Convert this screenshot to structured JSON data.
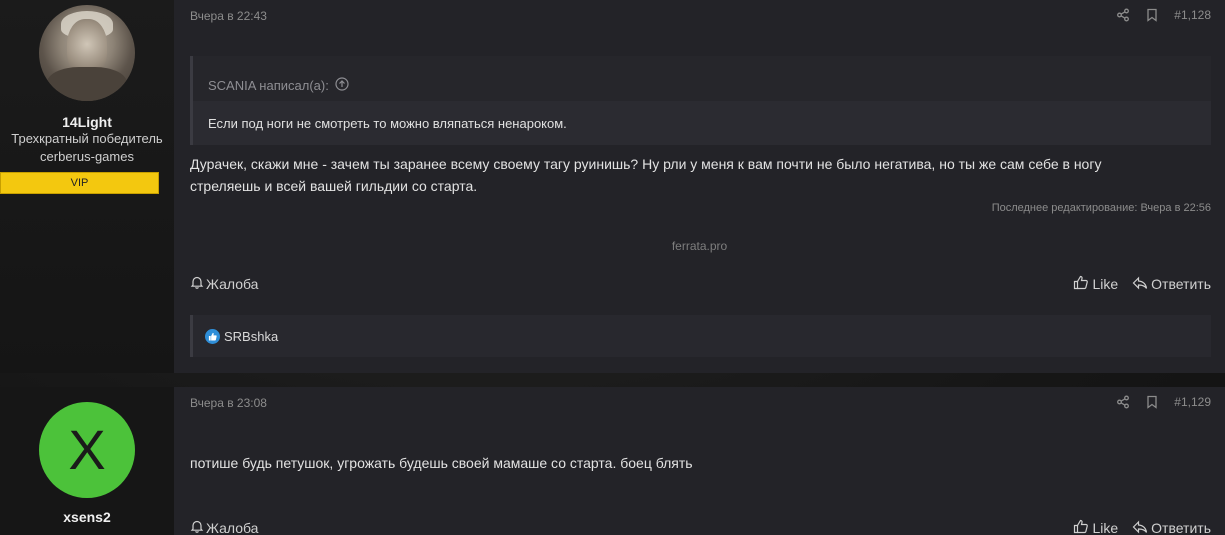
{
  "posts": [
    {
      "author": {
        "name": "14Light",
        "title_lines": [
          "Трехкратный победитель",
          "cerberus-games"
        ],
        "badge": "VIP",
        "avatar": "photo-avatar"
      },
      "date": "Вчера в 22:43",
      "number": "#1,128",
      "quote": {
        "author_line": "SCANIA написал(а):",
        "text": "Если под ноги не смотреть то можно вляпаться ненароком."
      },
      "text_lines": [
        "Дурачек, скажи мне - зачем ты заранее всему своему тагу руинишь? Ну рли у меня к вам почти не было негатива, но ты же сам себе в ногу",
        "стреляешь и всей вашей гильдии со старта."
      ],
      "edited": "Последнее редактирование: Вчера в 22:56",
      "signature": "ferrata.pro",
      "report_label": "Жалоба",
      "like_label": "Like",
      "reply_label": "Ответить",
      "reactions": "SRBshka"
    },
    {
      "author": {
        "name": "xsens2",
        "avatar_letter": "X",
        "avatar_color": "#4cc23a"
      },
      "date": "Вчера в 23:08",
      "number": "#1,129",
      "text_lines": [
        "потише будь петушок, угрожать будешь своей мамаше со старта. боец блять"
      ],
      "report_label": "Жалоба",
      "like_label": "Like",
      "reply_label": "Ответить"
    }
  ],
  "colors": {
    "badge": "#f3c80f",
    "post_bg": "#232328",
    "reaction_like": "#2f8ed8"
  }
}
